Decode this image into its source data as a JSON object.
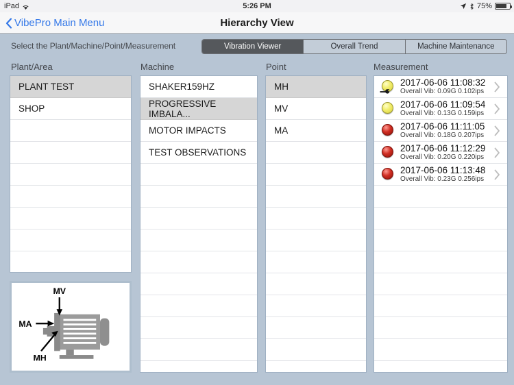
{
  "status_bar": {
    "device": "iPad",
    "wifi_icon": "wifi-icon",
    "time": "5:26 PM",
    "location_icon": "location-arrow-icon",
    "bluetooth_icon": "bluetooth-icon",
    "battery_percent": "75%",
    "battery_icon": "battery-icon"
  },
  "nav": {
    "back_icon": "chevron-left-icon",
    "back_label": "VibePro Main Menu",
    "title": "Hierarchy View"
  },
  "toolbar": {
    "instruction": "Select the Plant/Machine/Point/Measurement",
    "segments": [
      {
        "label": "Vibration Viewer",
        "selected": true
      },
      {
        "label": "Overall Trend",
        "selected": false
      },
      {
        "label": "Machine Maintenance",
        "selected": false
      }
    ]
  },
  "columns": {
    "plant": {
      "header": "Plant/Area",
      "items": [
        {
          "label": "PLANT TEST",
          "selected": true
        },
        {
          "label": "SHOP",
          "selected": false
        }
      ],
      "empty_rows": 7
    },
    "machine": {
      "header": "Machine",
      "items": [
        {
          "label": "SHAKER159HZ",
          "selected": false
        },
        {
          "label": "PROGRESSIVE IMBALA...",
          "selected": true
        },
        {
          "label": "MOTOR IMPACTS",
          "selected": false
        },
        {
          "label": "TEST OBSERVATIONS",
          "selected": false
        }
      ],
      "empty_rows": 9
    },
    "point": {
      "header": "Point",
      "items": [
        {
          "label": "MH",
          "selected": true
        },
        {
          "label": "MV",
          "selected": false
        },
        {
          "label": "MA",
          "selected": false
        }
      ],
      "empty_rows": 10
    },
    "measurement": {
      "header": "Measurement",
      "chevron_icon": "chevron-right-icon",
      "items": [
        {
          "timestamp": "2017-06-06 11:08:32",
          "detail": "Overall Vib: 0.09G 0.102ips",
          "status": "yellow",
          "status_icon": "yellow-led-icon",
          "has_wrench": true,
          "wrench_icon": "wrench-icon"
        },
        {
          "timestamp": "2017-06-06 11:09:54",
          "detail": "Overall Vib: 0.13G 0.159ips",
          "status": "yellow",
          "status_icon": "yellow-led-icon",
          "has_wrench": false
        },
        {
          "timestamp": "2017-06-06 11:11:05",
          "detail": "Overall Vib: 0.18G 0.207ips",
          "status": "red",
          "status_icon": "red-led-icon",
          "has_wrench": false
        },
        {
          "timestamp": "2017-06-06 11:12:29",
          "detail": "Overall Vib: 0.20G 0.220ips",
          "status": "red",
          "status_icon": "red-led-icon",
          "has_wrench": false
        },
        {
          "timestamp": "2017-06-06 11:13:48",
          "detail": "Overall Vib: 0.23G 0.256ips",
          "status": "red",
          "status_icon": "red-led-icon",
          "has_wrench": false
        }
      ],
      "empty_rows": 8
    }
  },
  "motor_diagram": {
    "name": "motor-orientation-diagram",
    "labels": {
      "vertical": "MV",
      "axial": "MA",
      "horizontal": "MH"
    }
  },
  "colors": {
    "background": "#b7c5d4",
    "accent_blue": "#3478e8",
    "segment_active": "#55585c",
    "row_selected": "#d6d6d6",
    "status_yellow": "#f2ee6e",
    "status_red": "#cf2d22"
  }
}
